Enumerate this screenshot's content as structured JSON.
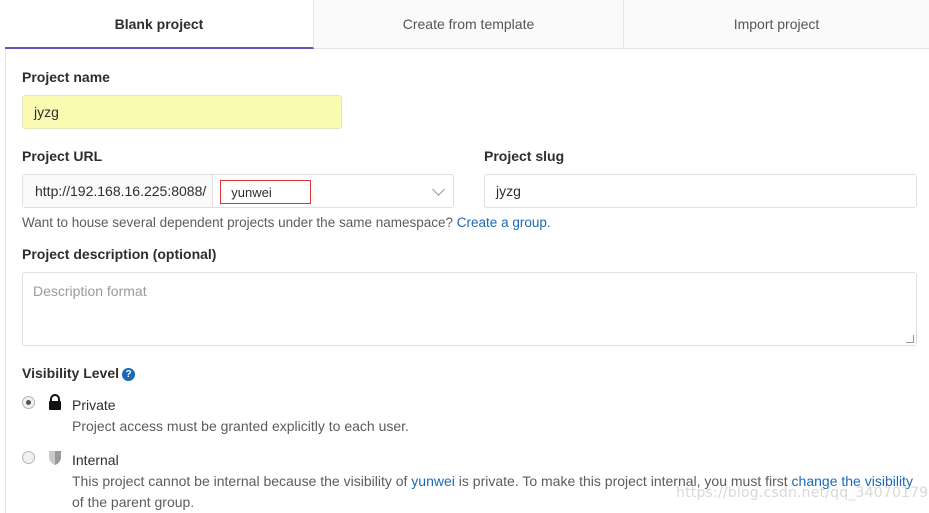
{
  "tabs": [
    {
      "label": "Blank project",
      "active": true
    },
    {
      "label": "Create from template",
      "active": false
    },
    {
      "label": "Import project",
      "active": false
    }
  ],
  "project_name": {
    "label": "Project name",
    "value": "jyzg"
  },
  "project_url": {
    "label": "Project URL",
    "prefix": "http://192.168.16.225:8088/",
    "namespace": "yunwei"
  },
  "project_slug": {
    "label": "Project slug",
    "value": "jyzg"
  },
  "namespace_help": {
    "text": "Want to house several dependent projects under the same namespace?",
    "link": "Create a group."
  },
  "description": {
    "label": "Project description (optional)",
    "placeholder": "Description format"
  },
  "visibility": {
    "label": "Visibility Level",
    "help_icon": "question-circle-icon",
    "options": [
      {
        "title": "Private",
        "icon": "lock-icon",
        "checked": true,
        "description": "Project access must be granted explicitly to each user."
      },
      {
        "title": "Internal",
        "icon": "shield-icon",
        "checked": false,
        "description_pre": "This project cannot be internal because the visibility of",
        "description_link1": "yunwei",
        "description_mid": "is private. To make this project internal, you must first",
        "description_link2": "change the visibility",
        "description_post": "of the parent group."
      }
    ]
  },
  "watermark": "https://blog.csdn.net/qq_34070179",
  "colors": {
    "accent": "#6b4fbb",
    "link": "#1b69b6",
    "name_field_bg": "#fafab2",
    "namespace_border": "#e03333"
  }
}
